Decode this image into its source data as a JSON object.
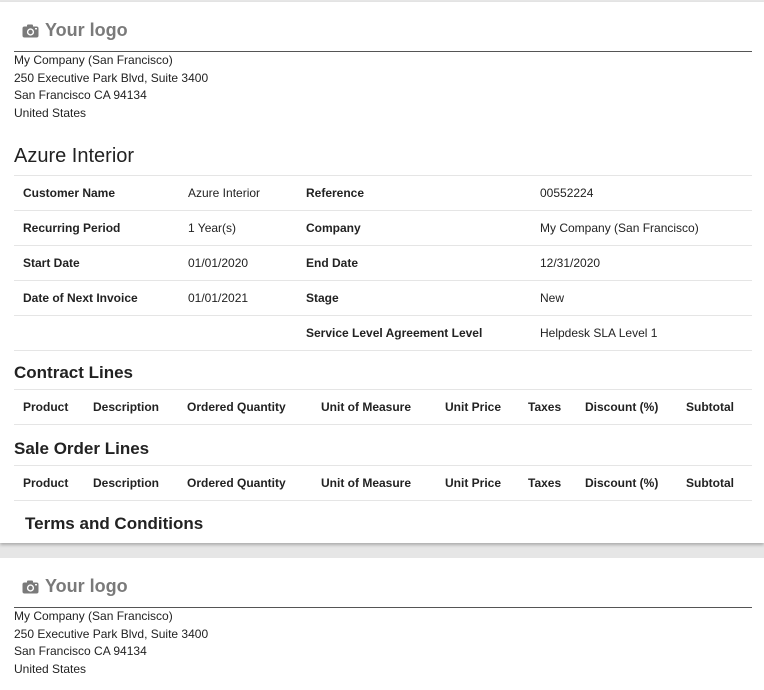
{
  "logo_text": "Your logo",
  "company_address": [
    "My Company (San Francisco)",
    "250 Executive Park Blvd, Suite 3400",
    "San Francisco CA 94134",
    "United States"
  ],
  "document_title": "Azure Interior",
  "info_rows": [
    {
      "l1": "Customer Name",
      "v1": "Azure Interior",
      "l2": "Reference",
      "v2": "00552224"
    },
    {
      "l1": "Recurring Period",
      "v1": "1 Year(s)",
      "l2": "Company",
      "v2": "My Company (San Francisco)"
    },
    {
      "l1": "Start Date",
      "v1": "01/01/2020",
      "l2": "End Date",
      "v2": "12/31/2020"
    },
    {
      "l1": "Date of Next Invoice",
      "v1": "01/01/2021",
      "l2": "Stage",
      "v2": "New"
    },
    {
      "l1": "",
      "v1": "",
      "l2": "Service Level Agreement Level",
      "v2": "Helpdesk SLA Level 1"
    }
  ],
  "contract_lines": {
    "title": "Contract Lines",
    "columns": [
      "Product",
      "Description",
      "Ordered Quantity",
      "Unit of Measure",
      "Unit Price",
      "Taxes",
      "Discount (%)",
      "Subtotal"
    ]
  },
  "sale_order_lines": {
    "title": "Sale Order Lines",
    "columns": [
      "Product",
      "Description",
      "Ordered Quantity",
      "Unit of Measure",
      "Unit Price",
      "Taxes",
      "Discount (%)",
      "Subtotal"
    ]
  },
  "terms_title": "Terms and Conditions"
}
